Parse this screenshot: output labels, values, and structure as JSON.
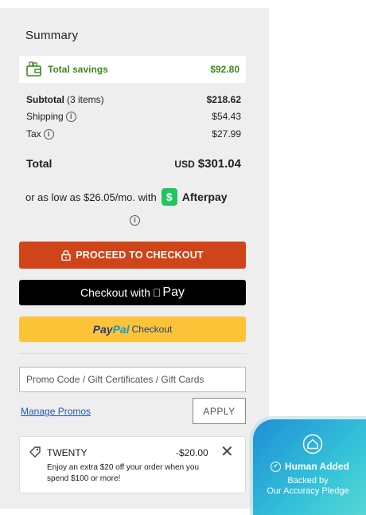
{
  "summary": {
    "title": "Summary"
  },
  "savings": {
    "label": "Total savings",
    "value": "$92.80"
  },
  "subtotal": {
    "label": "Subtotal",
    "count": "(3 items)",
    "value": "$218.62"
  },
  "shipping": {
    "label": "Shipping",
    "value": "$54.43"
  },
  "tax": {
    "label": "Tax",
    "value": "$27.99"
  },
  "total": {
    "label": "Total",
    "currency": "USD",
    "value": "$301.04"
  },
  "afterpay": {
    "text": "or as low as $26.05/mo. with",
    "brand": "Afterpay"
  },
  "buttons": {
    "checkout": "PROCEED TO CHECKOUT",
    "apple_prefix": "Checkout with",
    "apple_pay": "Pay",
    "paypal_pay": "Pay",
    "paypal_pal": "Pal",
    "paypal_checkout": "Checkout"
  },
  "promo": {
    "placeholder": "Promo Code / Gift Certificates / Gift Cards",
    "manage_label": "Manage Promos",
    "apply_label": "APPLY"
  },
  "coupon": {
    "code": "TWENTY",
    "amount": "-$20.00",
    "description": "Enjoy an extra $20 off your order when you spend $100 or more!"
  },
  "pledge": {
    "title": "Human Added",
    "line1": "Backed by",
    "line2": "Our Accuracy Pledge"
  },
  "colors": {
    "panel_bg": "#eeeeee",
    "savings_green": "#3d8c1e",
    "checkout_orange": "#d0441a",
    "paypal_yellow": "#fbc438",
    "link_blue": "#2359b5"
  }
}
